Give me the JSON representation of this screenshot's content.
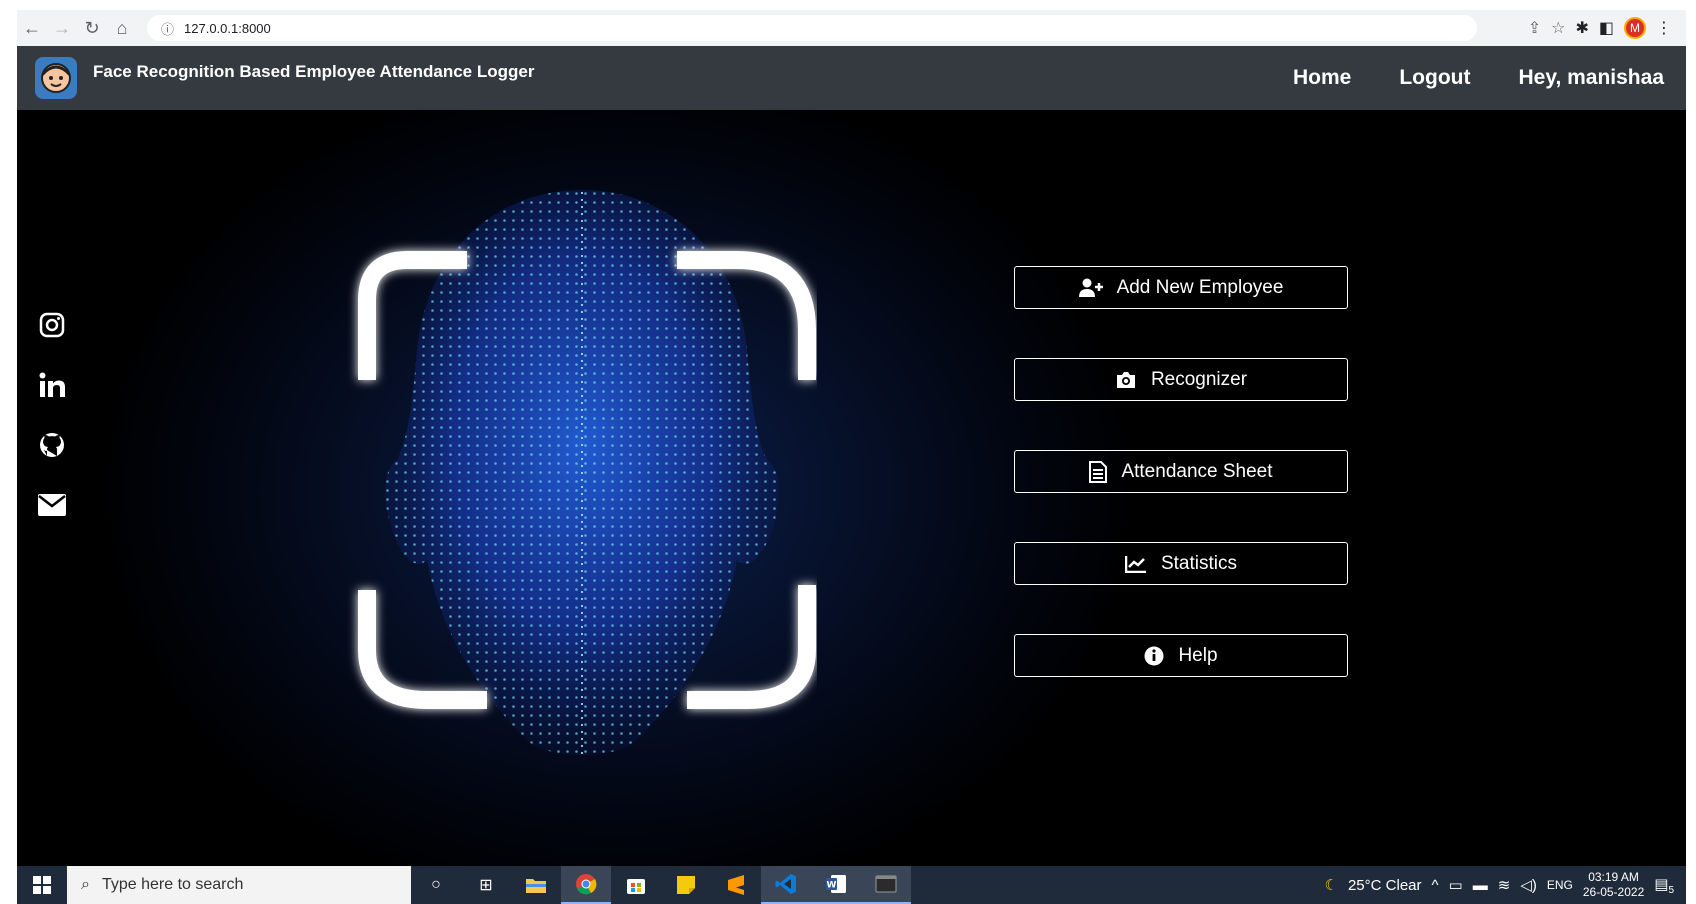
{
  "browser": {
    "url": "127.0.0.1:8000",
    "profile_initial": "M"
  },
  "navbar": {
    "brand": "Face Recognition Based Employee Attendance Logger",
    "links": [
      "Home",
      "Logout",
      "Hey, manishaa"
    ]
  },
  "social": [
    "instagram-icon",
    "linkedin-icon",
    "github-icon",
    "mail-icon"
  ],
  "actions": [
    {
      "label": "Add New Employee",
      "icon": "user-plus-icon"
    },
    {
      "label": "Recognizer",
      "icon": "camera-icon"
    },
    {
      "label": "Attendance Sheet",
      "icon": "file-icon"
    },
    {
      "label": "Statistics",
      "icon": "chart-line-icon"
    },
    {
      "label": "Help",
      "icon": "info-icon"
    }
  ],
  "taskbar": {
    "search_placeholder": "Type here to search",
    "weather": "25°C  Clear",
    "lang": "ENG",
    "time": "03:19 AM",
    "date": "26-05-2022",
    "notifications": "5"
  }
}
